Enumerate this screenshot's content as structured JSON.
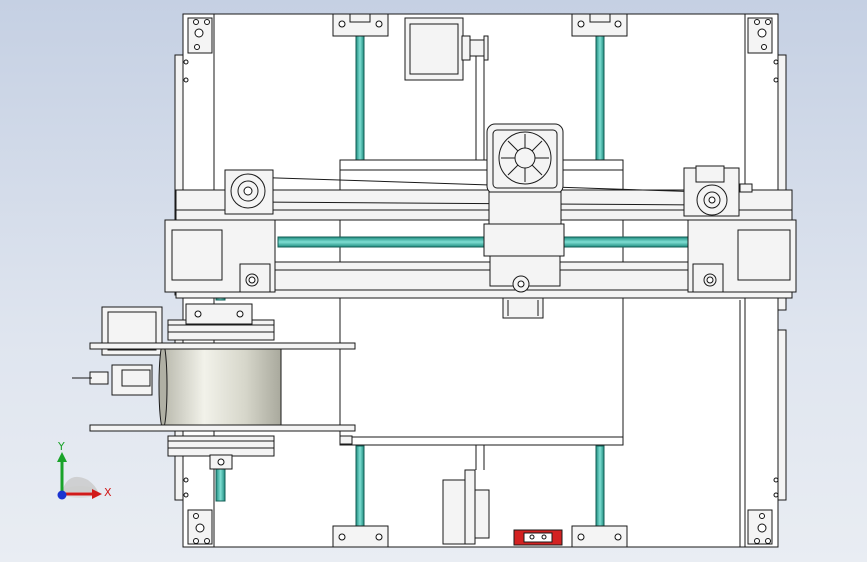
{
  "viewport": {
    "background_top": "#c5d0e3",
    "background_bottom": "#e9edf3"
  },
  "colors": {
    "rod": "#2fa99b",
    "rod_highlight": "#7fded3",
    "outline": "#1a1a1a",
    "part_fill": "#f4f4f4",
    "spool": "#d8d8cc",
    "clip_red": "#d32222"
  },
  "triad": {
    "y_label": "Y",
    "x_label": "X",
    "y_color": "#1aa32a",
    "x_color": "#d11a1a",
    "z_color": "#1a33d1"
  }
}
